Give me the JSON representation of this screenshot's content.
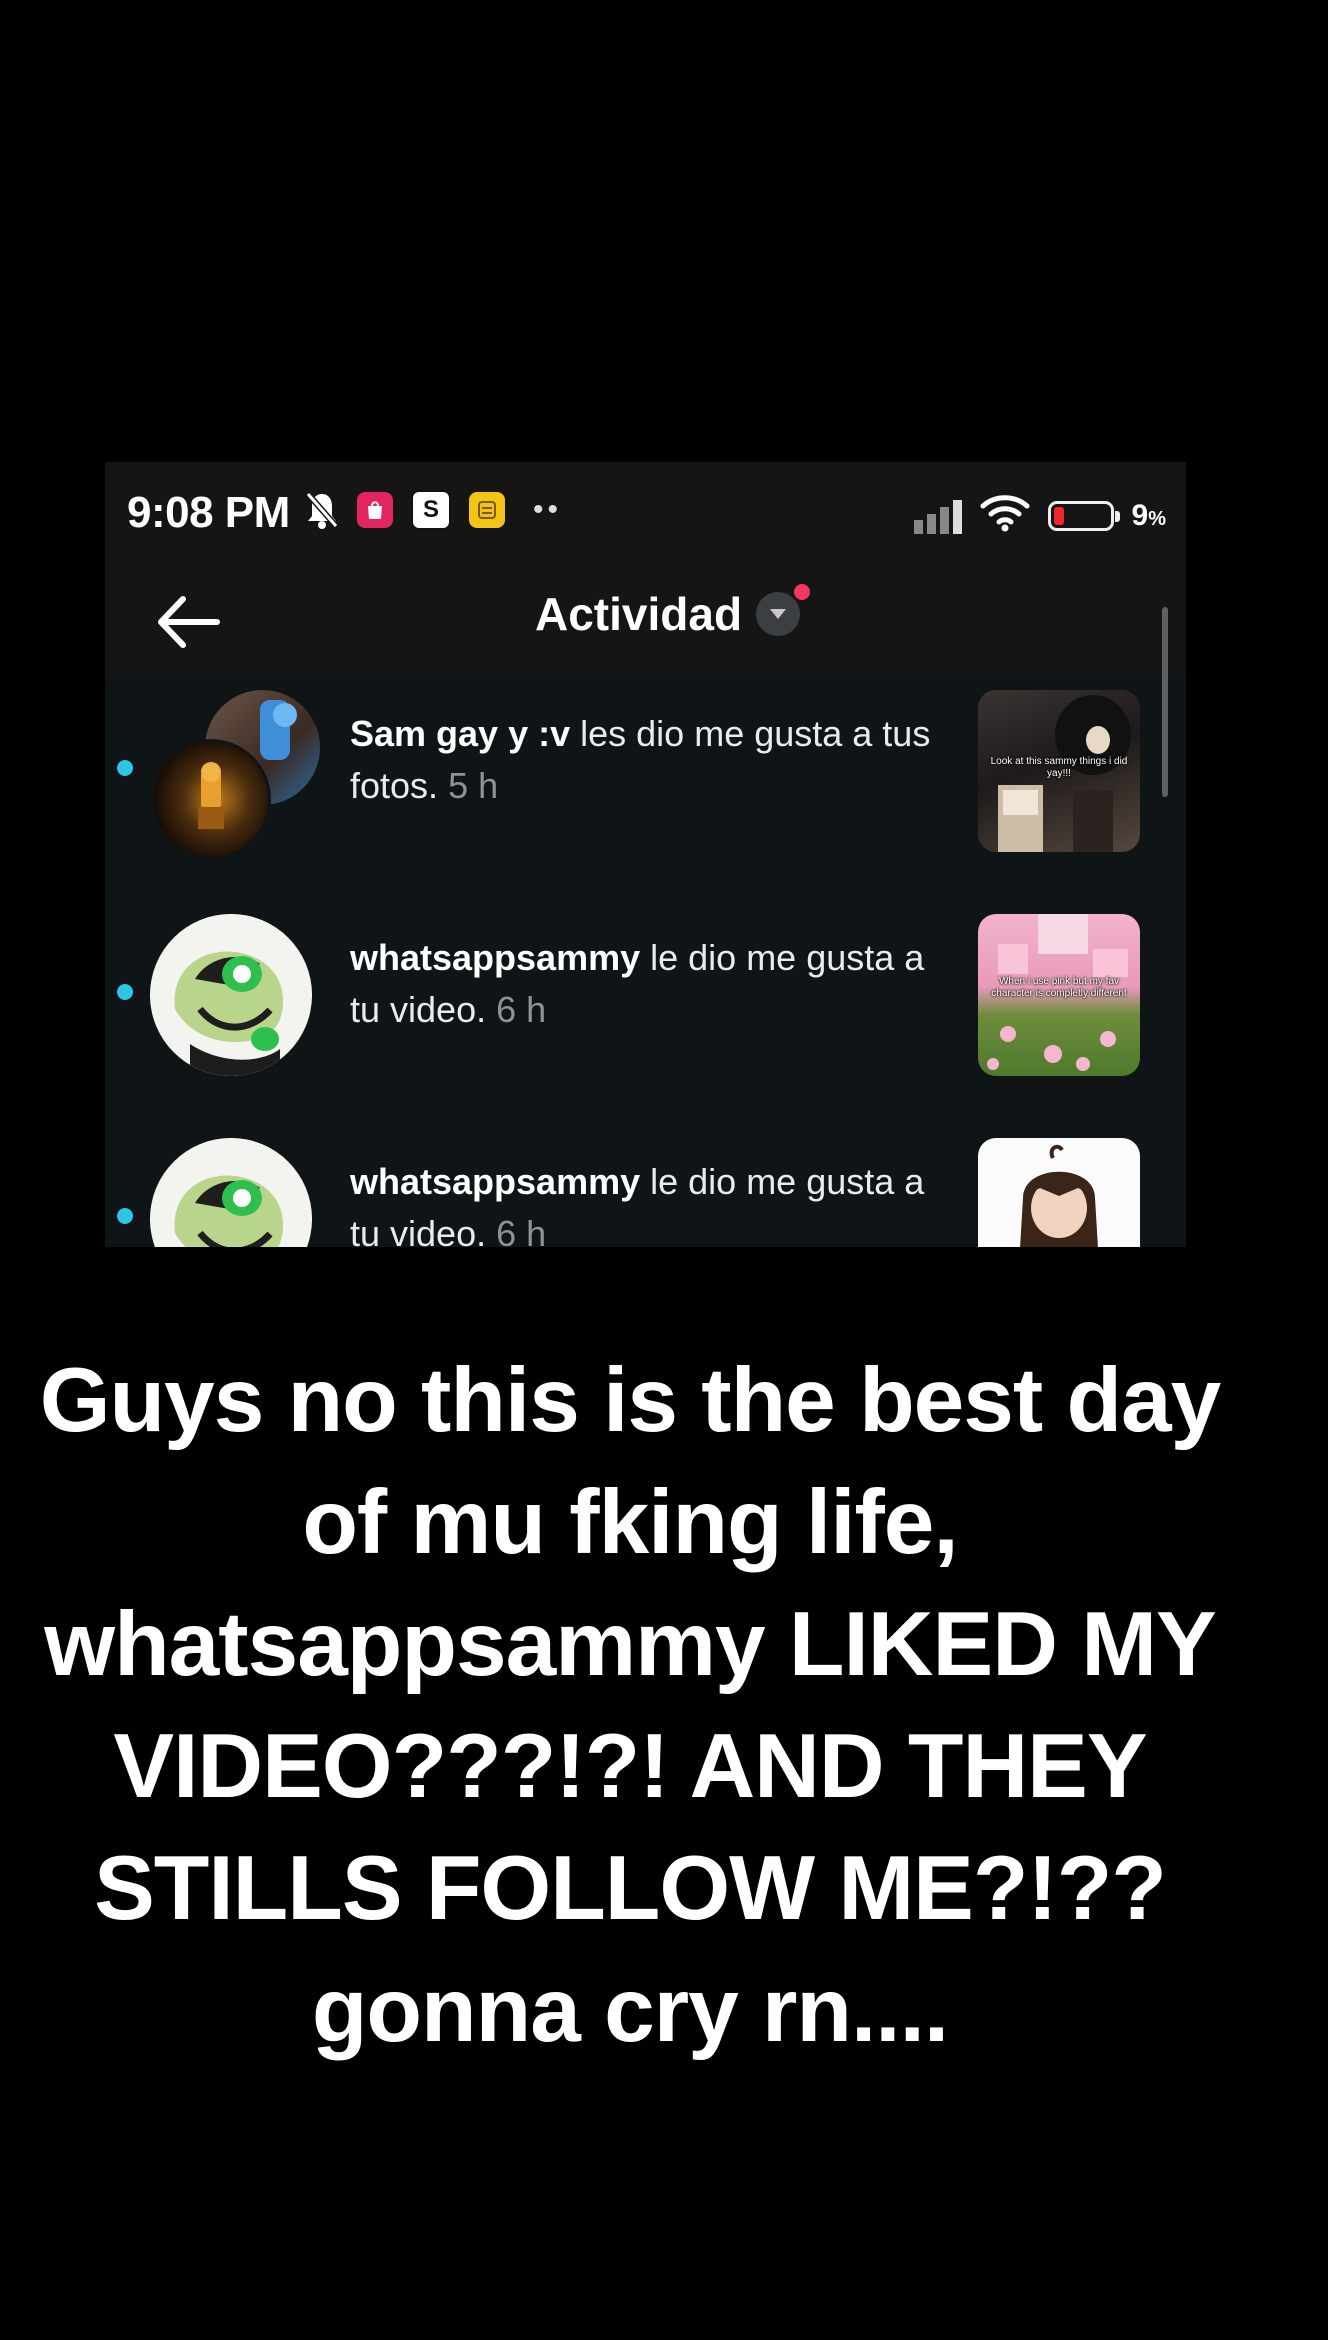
{
  "status_bar": {
    "time": "9:08 PM",
    "app_s_label": "S",
    "battery_percent": "9",
    "battery_percent_sign": "%",
    "battery_level": 0.09
  },
  "app_bar": {
    "title": "Actividad"
  },
  "notifications": [
    {
      "user": "Sam gay y :v",
      "action": "les dio me gusta a tus fotos.",
      "time": "5 h",
      "unread": true,
      "thumb_caption": "Look at this sammy things i did yay!!!"
    },
    {
      "user": "whatsappsammy",
      "action": "le dio me gusta a tu video.",
      "time": "6 h",
      "unread": true,
      "thumb_caption": "When i use pink but my fav character is completly different"
    },
    {
      "user": "whatsappsammy",
      "action": "le dio me gusta a tu video.",
      "time": "6 h",
      "unread": true,
      "thumb_caption": ""
    }
  ],
  "overlay_caption": {
    "line1": "Guys no this is the best day",
    "line2": "of mu fking life,",
    "line3": "whatsappsammy LIKED MY",
    "line4": "VIDEO???!?! AND THEY",
    "line5": "STILLS FOLLOW ME?!??",
    "line6": "gonna cry rn...."
  },
  "colors": {
    "background": "#000000",
    "feed_background": "#0f1517",
    "unread_dot": "#2ec6e8",
    "notification_dot": "#f4385f"
  }
}
